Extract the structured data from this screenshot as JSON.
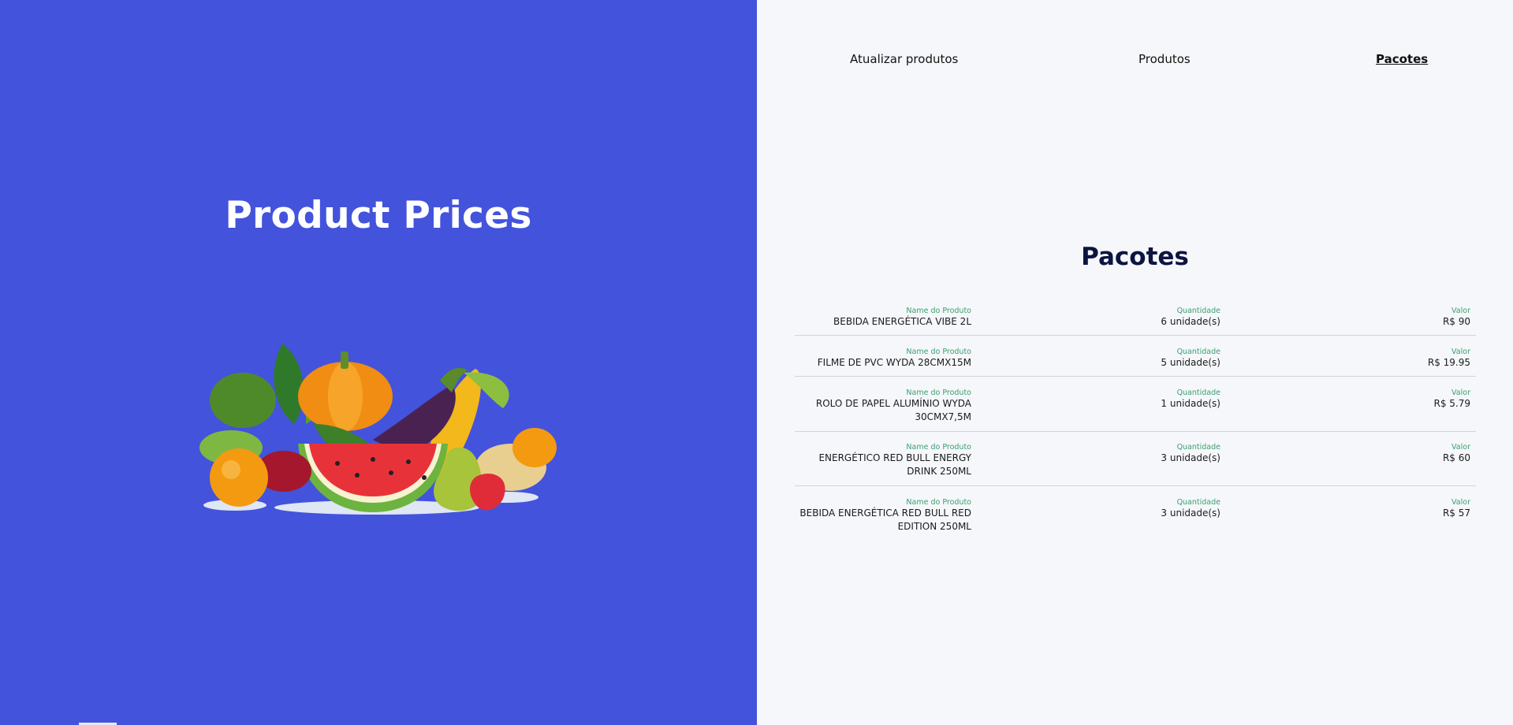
{
  "brand": {
    "title": "Product Prices"
  },
  "nav": {
    "items": [
      {
        "label": "Atualizar produtos"
      },
      {
        "label": "Produtos"
      },
      {
        "label": "Pacotes"
      }
    ]
  },
  "section": {
    "title": "Pacotes"
  },
  "columns": {
    "name": "Name do Produto",
    "quantity": "Quantidade",
    "value": "Valor"
  },
  "rows": [
    {
      "name": "BEBIDA ENERGÉTICA VIBE 2L",
      "quantity": "6 unidade(s)",
      "value": "R$ 90"
    },
    {
      "name": "FILME DE PVC WYDA 28CMX15M",
      "quantity": "5 unidade(s)",
      "value": "R$ 19.95"
    },
    {
      "name": "ROLO DE PAPEL ALUMÍNIO WYDA 30CMX7,5M",
      "quantity": "1 unidade(s)",
      "value": "R$ 5.79"
    },
    {
      "name": "ENERGÉTICO RED BULL ENERGY DRINK 250ML",
      "quantity": "3 unidade(s)",
      "value": "R$ 60"
    },
    {
      "name": "BEBIDA ENERGÉTICA RED BULL RED EDITION 250ML",
      "quantity": "3 unidade(s)",
      "value": "R$ 57"
    }
  ],
  "colors": {
    "brand_blue": "#4353dc",
    "label_green": "#3ba06c",
    "title_navy": "#0c1440",
    "page_bg": "#f5f7fb"
  },
  "icons": {
    "hero": "fruits-vegetables-illustration"
  }
}
